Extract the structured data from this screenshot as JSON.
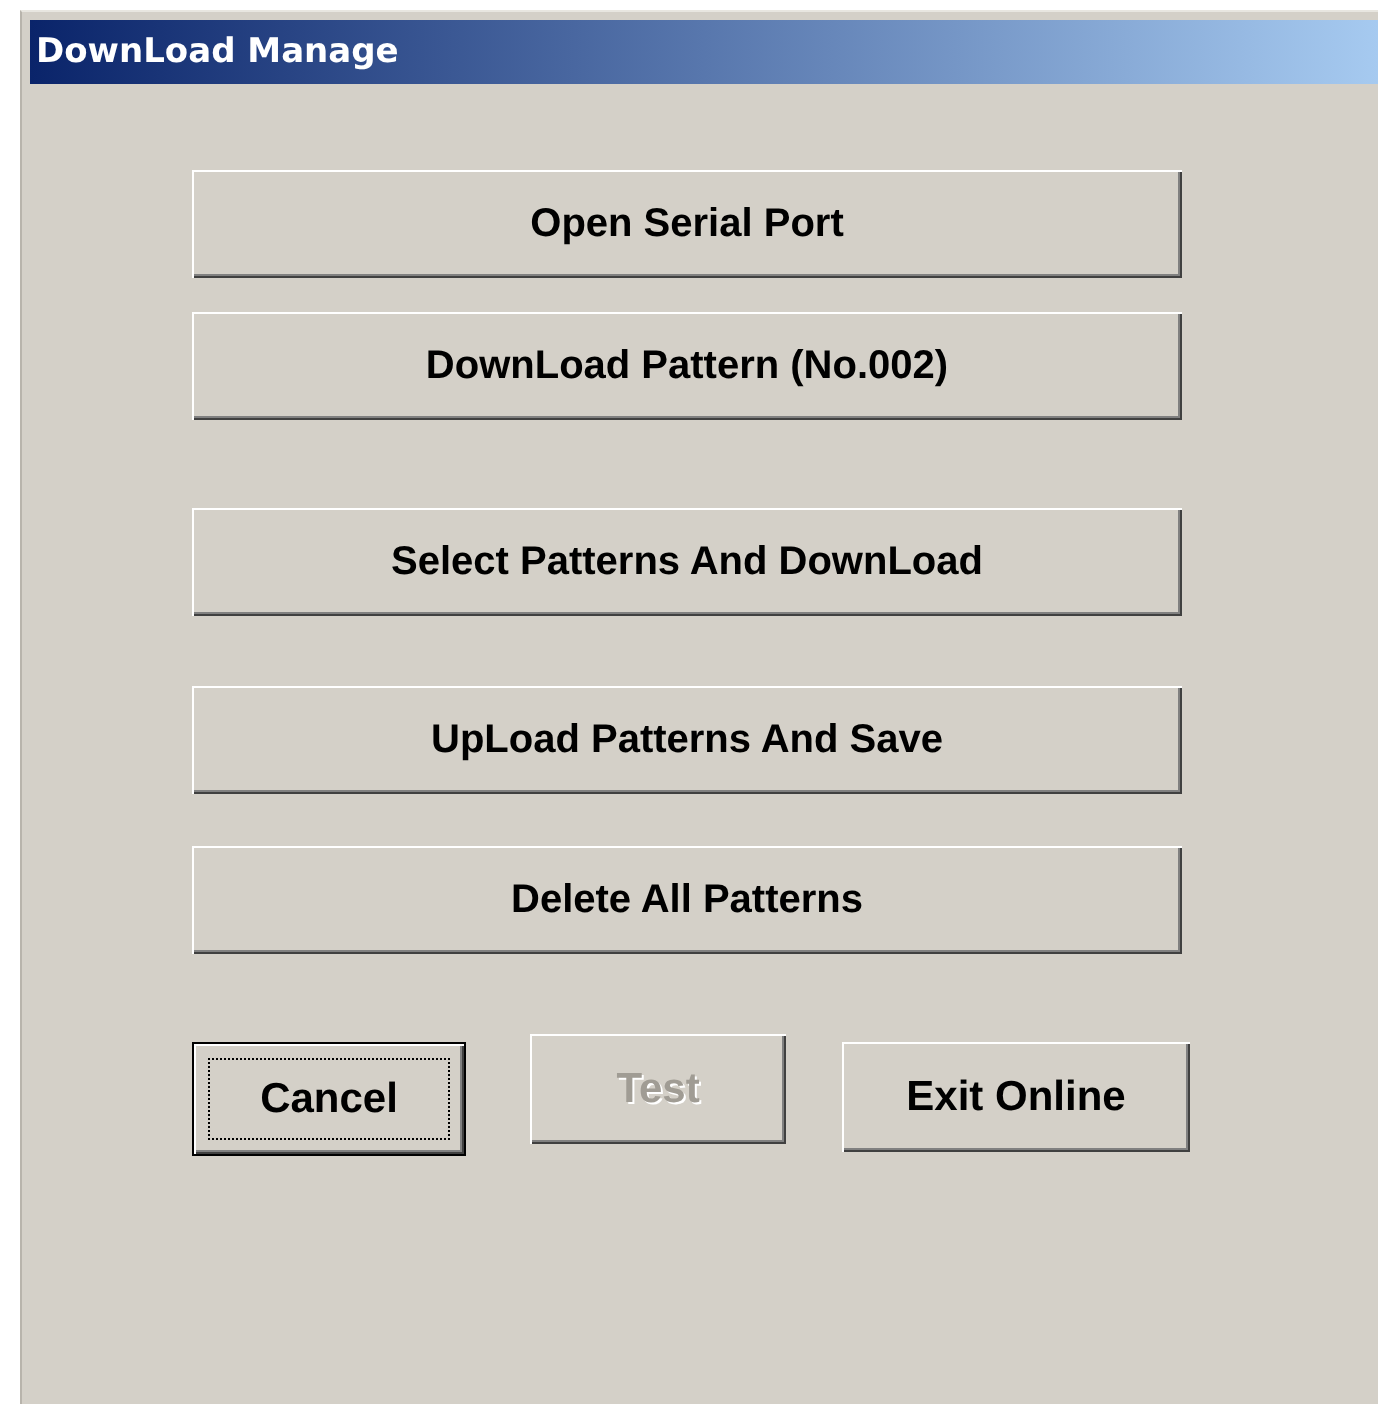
{
  "window": {
    "title": "DownLoad Manage"
  },
  "actions": [
    {
      "label": "Open Serial Port"
    },
    {
      "label": "DownLoad Pattern (No.002)"
    },
    {
      "label": "Select Patterns And DownLoad"
    },
    {
      "label": "UpLoad Patterns And Save"
    },
    {
      "label": "Delete All Patterns"
    }
  ],
  "buttons": [
    {
      "label": "Cancel",
      "disabled": false,
      "focused": true
    },
    {
      "label": "Test",
      "disabled": true,
      "focused": false
    },
    {
      "label": "Exit Online",
      "disabled": false,
      "focused": false
    }
  ]
}
